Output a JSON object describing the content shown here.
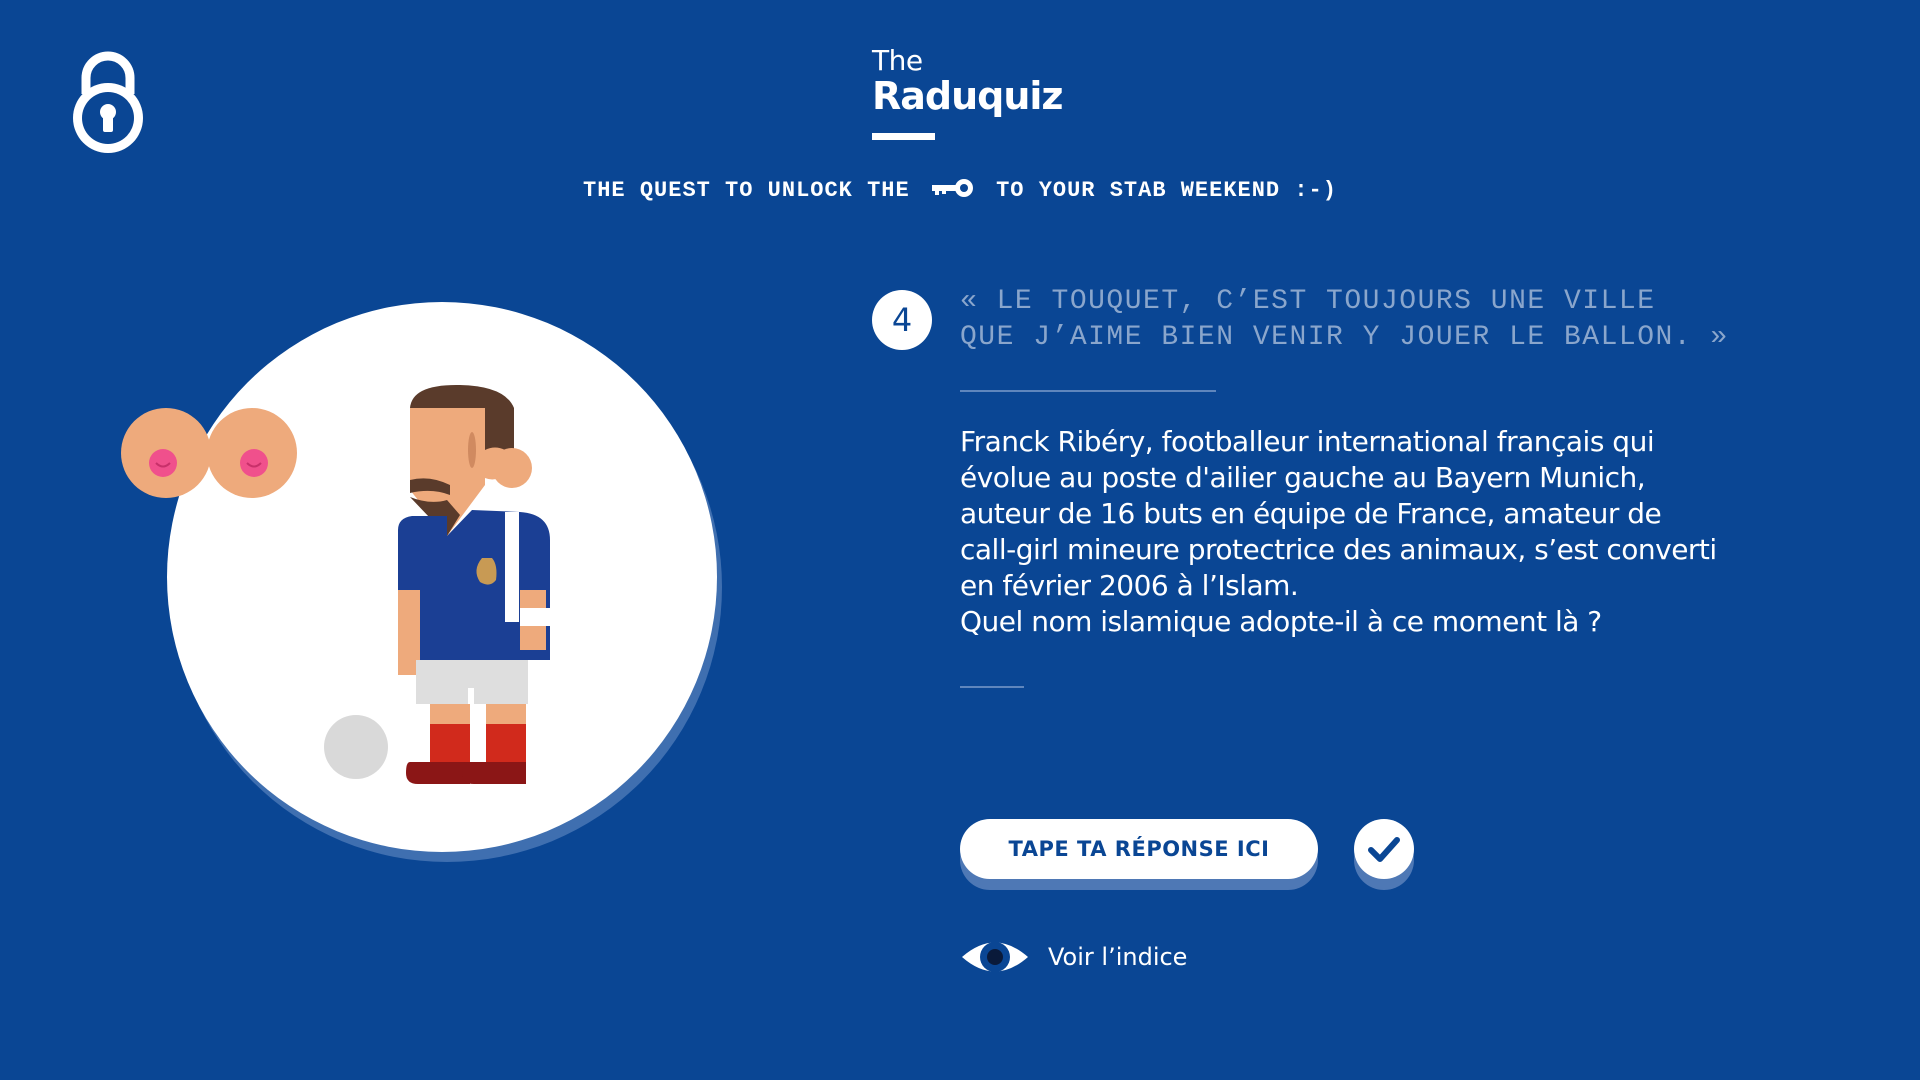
{
  "header": {
    "logo_the": "The",
    "logo_name": "Raduquiz",
    "tagline_before": "THE QUEST TO UNLOCK THE",
    "tagline_after": "TO YOUR STAB WEEKEND :-)"
  },
  "icons": {
    "lock": "lock-icon",
    "key": "key-icon",
    "check": "check-icon",
    "eye": "eye-icon"
  },
  "question": {
    "number": "4",
    "quote_line1": "« LE TOUQUET, C’EST TOUJOURS UNE VILLE",
    "quote_line2": "QUE J’AIME BIEN VENIR Y JOUER LE BALLON. »",
    "description_lines": [
      "Franck Ribéry, footballeur international français qui",
      "évolue au poste d'ailier gauche au Bayern Munich,",
      "auteur de 16 buts en équipe de France, amateur de",
      "call-girl mineure protectrice des animaux, s’est converti",
      "en février 2006 à l’Islam.",
      "Quel nom islamique adopte-il à ce moment là ?"
    ]
  },
  "answer": {
    "placeholder": "TAPE TA RÉPONSE ICI"
  },
  "hint": {
    "label": "Voir l’indice"
  },
  "colors": {
    "background": "#0a4694",
    "quote": "#8aa6cc",
    "shadow": "#4e78b5",
    "skin": "#eeaa7c",
    "nipple": "#f0508c"
  }
}
